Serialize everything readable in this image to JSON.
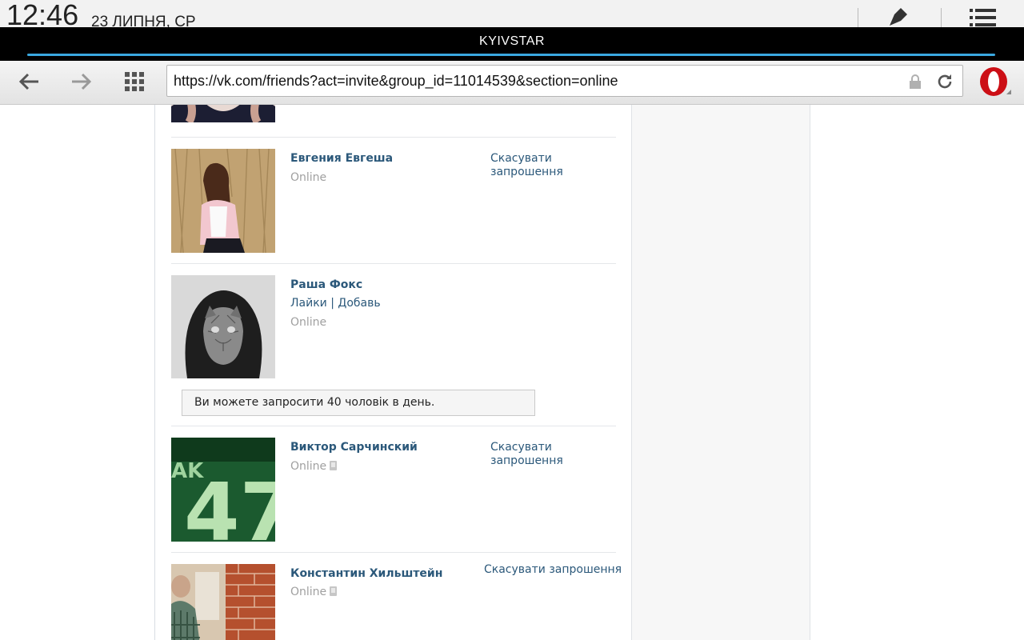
{
  "statusbar": {
    "time": "12:46",
    "date": "23 ЛИПНЯ, СР"
  },
  "carrier": {
    "name": "KYIVSTAR"
  },
  "browser": {
    "url": "https://vk.com/friends?act=invite&group_id=11014539&section=online",
    "icons": [
      "back-arrow-icon",
      "forward-arrow-icon",
      "speed-dial-grid-icon",
      "lock-icon",
      "reload-icon",
      "opera-logo-icon"
    ]
  },
  "friends": [
    {
      "name": "Евгения Евгеша",
      "status": "Online",
      "action": "Скасувати запрошення"
    },
    {
      "name": "Раша Фокс",
      "links": "Лайки | Добавь",
      "status": "Online"
    },
    {
      "name": "Виктор Сарчинский",
      "status": "Online",
      "action": "Скасувати запрошення"
    },
    {
      "name": "Константин Хильштейн",
      "status": "Online",
      "action": "Скасувати запрошення"
    }
  ],
  "notice": {
    "text": "Ви можете запросити 40 чоловік в день."
  },
  "colors": {
    "link": "#2b587a",
    "muted": "#a0a0a0",
    "carrier_bar": "#000000",
    "progress": "#3aa8e0"
  }
}
